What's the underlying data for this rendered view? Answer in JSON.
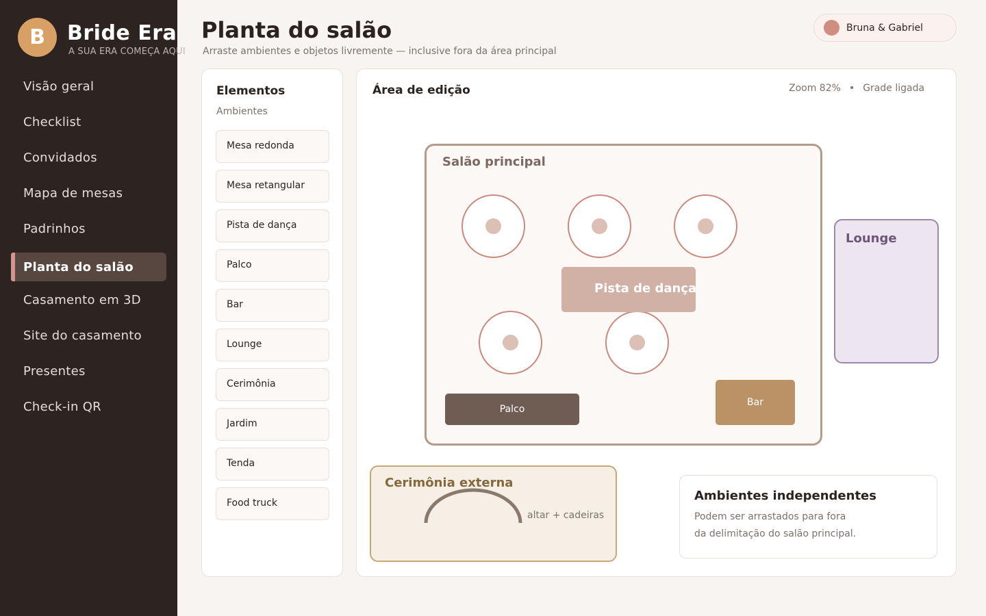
{
  "brand": {
    "initial": "B",
    "name": "Bride Era",
    "tagline": "A SUA ERA COMEÇA AQUI"
  },
  "sidebar": {
    "items": [
      {
        "label": "Visão geral"
      },
      {
        "label": "Checklist"
      },
      {
        "label": "Convidados"
      },
      {
        "label": "Mapa de mesas"
      },
      {
        "label": "Padrinhos"
      },
      {
        "label": "Planta do salão",
        "active": true
      },
      {
        "label": "Casamento em 3D"
      },
      {
        "label": "Site do casamento"
      },
      {
        "label": "Presentes"
      },
      {
        "label": "Check-in QR"
      }
    ]
  },
  "header": {
    "title": "Planta do salão",
    "subtitle": "Arraste ambientes e objetos livremente — inclusive fora da área principal",
    "user": "Bruna & Gabriel"
  },
  "elements": {
    "title": "Elementos",
    "section": "Ambientes",
    "items": [
      "Mesa redonda",
      "Mesa retangular",
      "Pista de dança",
      "Palco",
      "Bar",
      "Lounge",
      "Cerimônia",
      "Jardim",
      "Tenda",
      "Food truck"
    ]
  },
  "editor": {
    "title": "Área de edição",
    "zoom": "Zoom 82%",
    "separator": "•",
    "grid": "Grade ligada"
  },
  "canvas": {
    "main_hall": "Salão principal",
    "dance_floor": "Pista de dança",
    "stage": "Palco",
    "bar": "Bar",
    "lounge": "Lounge",
    "ceremony": "Cerimônia externa",
    "ceremony_note": "altar + cadeiras",
    "round_tables": 5
  },
  "info": {
    "title": "Ambientes independentes",
    "line1": "Podem ser arrastados para fora",
    "line2": "da delimitação do salão principal."
  },
  "colors": {
    "sidebar_bg": "#2d2421",
    "accent": "#d4958a",
    "logo": "#d9a065",
    "table_border": "#c9897c",
    "dance_floor": "#d1b0a6",
    "stage": "#6f5c53",
    "bar": "#bb9166",
    "lounge_border": "#9c86aa",
    "ceremony_border": "#c8a774"
  }
}
